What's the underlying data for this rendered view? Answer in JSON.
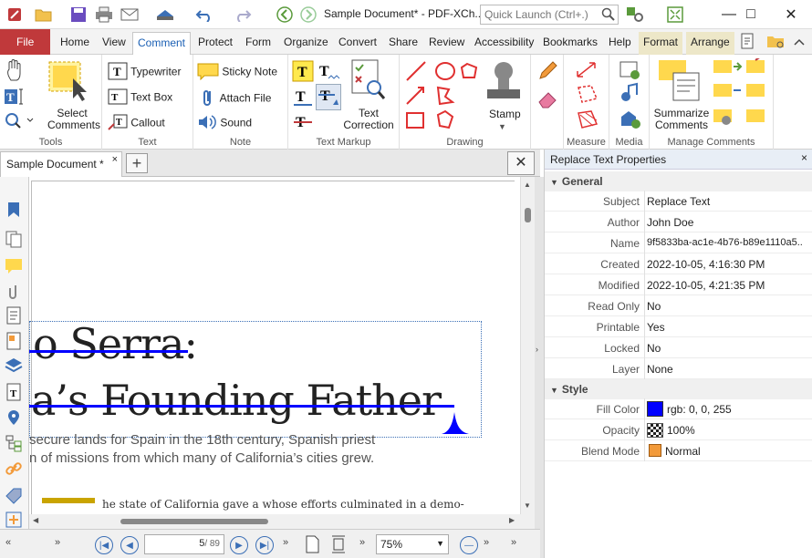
{
  "window": {
    "title": "Sample Document* - PDF-XCh...",
    "quick_launch_placeholder": "Quick Launch (Ctrl+.)"
  },
  "menu": {
    "file": "File",
    "tabs": [
      "Home",
      "View",
      "Comment",
      "Protect",
      "Form",
      "Organize",
      "Convert",
      "Share",
      "Review",
      "Accessibility",
      "Bookmarks",
      "Help"
    ],
    "context_tabs": [
      "Format",
      "Arrange"
    ],
    "active_tab": "Comment"
  },
  "ribbon": {
    "tools": {
      "label": "Tools",
      "select_comments": "Select Comments"
    },
    "text": {
      "label": "Text",
      "typewriter": "Typewriter",
      "text_box": "Text Box",
      "callout": "Callout"
    },
    "note": {
      "label": "Note",
      "sticky_note": "Sticky Note",
      "attach_file": "Attach File",
      "sound": "Sound"
    },
    "text_markup": {
      "label": "Text Markup",
      "text_correction": "Text Correction"
    },
    "drawing": {
      "label": "Drawing",
      "stamp": "Stamp"
    },
    "measure": {
      "label": "Measure"
    },
    "media": {
      "label": "Media"
    },
    "manage": {
      "label": "Manage Comments",
      "summarize": "Summarize Comments"
    }
  },
  "document": {
    "tab_title": "Sample Document *",
    "heading_line1": "o Serra:",
    "heading_line2": "a’s Founding Father",
    "body_line1": "secure lands for Spain in the 18th century, Spanish priest",
    "body_line2": "n of missions from which many of California’s cities grew.",
    "body_line3": "he state of California gave a   whose efforts culminated in a demo-"
  },
  "status": {
    "page_value": "5",
    "page_total": "/ 89",
    "zoom": "75%"
  },
  "panel": {
    "title": "Replace Text Properties",
    "general_label": "General",
    "general": [
      {
        "key": "Subject",
        "value": "Replace Text"
      },
      {
        "key": "Author",
        "value": "John Doe"
      },
      {
        "key": "Name",
        "value": "9f5833ba-ac1e-4b76-b89e1110a5.."
      },
      {
        "key": "Created",
        "value": "2022-10-05, 4:16:30 PM"
      },
      {
        "key": "Modified",
        "value": "2022-10-05, 4:21:35 PM"
      },
      {
        "key": "Read Only",
        "value": "No"
      },
      {
        "key": "Printable",
        "value": "Yes"
      },
      {
        "key": "Locked",
        "value": "No"
      },
      {
        "key": "Layer",
        "value": "None"
      }
    ],
    "style_label": "Style",
    "style": [
      {
        "key": "Fill Color",
        "value": "rgb: 0, 0, 255"
      },
      {
        "key": "Opacity",
        "value": "100%"
      },
      {
        "key": "Blend Mode",
        "value": "Normal"
      }
    ]
  },
  "colors": {
    "accent": "#1a5fb4",
    "file_tab": "#c0393b",
    "strike_line": "#0000ff",
    "context_tab": "#ede7c8",
    "fill_color": "#0000ff"
  }
}
